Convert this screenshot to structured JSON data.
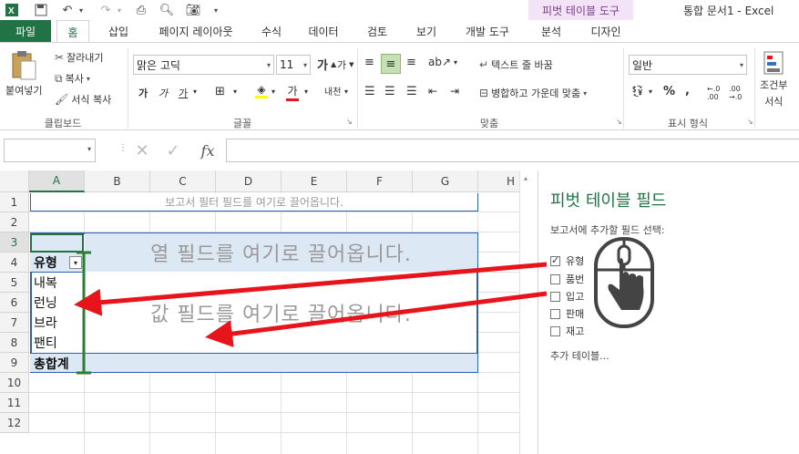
{
  "title_bar": {
    "contextual_tab": "피벗 테이블 도구",
    "document_title": "통합 문서1 - Excel"
  },
  "tabs": {
    "file": "파일",
    "home": "홈",
    "insert": "삽입",
    "page_layout": "페이지 레이아웃",
    "formulas": "수식",
    "data": "데이터",
    "review": "검토",
    "view": "보기",
    "developer": "개발 도구",
    "analyze": "분석",
    "design": "디자인"
  },
  "ribbon": {
    "paste": "붙여넣기",
    "cut": "잘라내기",
    "copy": "복사",
    "format_painter": "서식 복사",
    "clipboard_label": "클립보드",
    "font_name": "맑은 고딕",
    "font_size": "11",
    "font_label": "글꼴",
    "wrap_text": "텍스트 줄 바꿈",
    "merge_center": "병합하고 가운데 맞춤",
    "alignment_label": "맞춤",
    "number_format": "일반",
    "number_label": "표시 형식",
    "conditional_format": "조건부",
    "conditional_format_2": "서식"
  },
  "formula_bar": {
    "fx": "fx",
    "value": ""
  },
  "grid": {
    "columns": [
      "A",
      "B",
      "C",
      "D",
      "E",
      "F",
      "G",
      "H"
    ],
    "rows": [
      "1",
      "2",
      "3",
      "4",
      "5",
      "6",
      "7",
      "8",
      "9",
      "10",
      "11",
      "12"
    ],
    "report_filter_hint": "보고서 필터 필드를 여기로 끌어옵니다.",
    "column_fields_hint": "열 필드를 여기로 끌어옵니다.",
    "values_hint": "값 필드를 여기로 끌어옵니다.",
    "row_header": "유형",
    "row_items": [
      "내복",
      "런닝",
      "브라",
      "팬티"
    ],
    "grand_total": "총합계"
  },
  "pivot_panel": {
    "title": "피벗 테이블 필드",
    "subtitle": "보고서에 추가할 필드 선택:",
    "fields": [
      {
        "label": "유형",
        "checked": true
      },
      {
        "label": "품번",
        "checked": false
      },
      {
        "label": "입고",
        "checked": false
      },
      {
        "label": "판매",
        "checked": false
      },
      {
        "label": "재고",
        "checked": false
      }
    ],
    "more_tables": "추가 테이블..."
  },
  "colors": {
    "excel_green": "#217346",
    "pivot_tab_bg": "#f3e3f6",
    "pivot_tab_text": "#7a3b8a",
    "drop_zone_fill": "#dde8f5",
    "drop_zone_border": "#2e5fb0",
    "arrow": "#e8141c",
    "bracket": "#2e7d32"
  }
}
